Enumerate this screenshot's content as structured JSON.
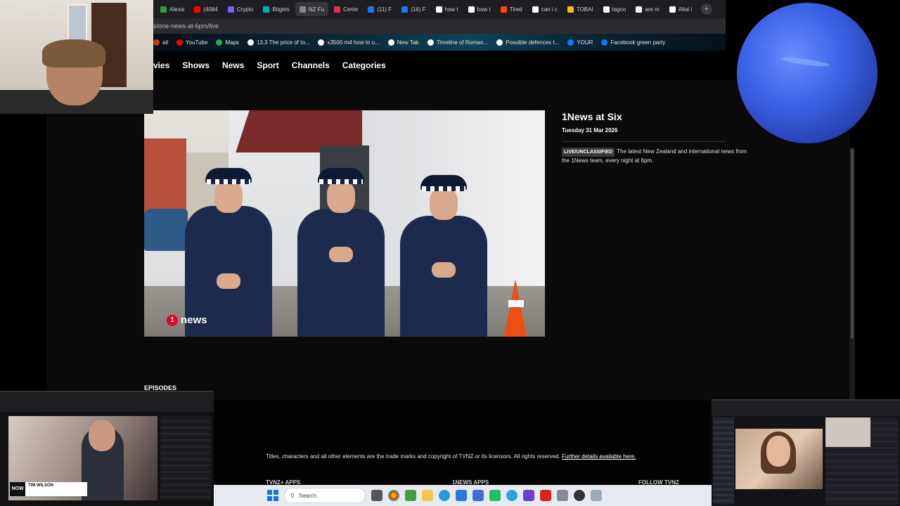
{
  "browser": {
    "tabs": [
      {
        "label": "Alexis",
        "color": "#2ea043"
      },
      {
        "label": "(4084",
        "color": "#ff0000"
      },
      {
        "label": "Crypto",
        "color": "#7a5cff"
      },
      {
        "label": "Bitgets",
        "color": "#00b3b3"
      },
      {
        "label": "NZ Fu",
        "color": "#888888",
        "active": true
      },
      {
        "label": "Cente",
        "color": "#e03050"
      },
      {
        "label": "(11) F",
        "color": "#1877f2"
      },
      {
        "label": "(16) F",
        "color": "#1877f2"
      },
      {
        "label": "how t",
        "color": "#ffffff"
      },
      {
        "label": "how t",
        "color": "#ffffff"
      },
      {
        "label": "Tired",
        "color": "#ff4500"
      },
      {
        "label": "can i c",
        "color": "#ffffff"
      },
      {
        "label": "TOBAI",
        "color": "#f0c020"
      },
      {
        "label": "logno",
        "color": "#ffffff"
      },
      {
        "label": "are m",
        "color": "#ffffff"
      },
      {
        "label": "Altai I",
        "color": "#ffffff"
      }
    ],
    "new_tab": "+",
    "address": "s/one-news-at-6pm/live",
    "bookmarks": [
      {
        "label": "ail",
        "color": "#d93025"
      },
      {
        "label": "YouTube",
        "color": "#ff0000"
      },
      {
        "label": "Maps",
        "color": "#34a853"
      },
      {
        "label": "13.3 The price of to...",
        "color": "#ffffff"
      },
      {
        "label": "x3500 m4 how to u...",
        "color": "#ffffff"
      },
      {
        "label": "New Tab",
        "color": "#ffffff"
      },
      {
        "label": "Timeline of Roman...",
        "color": "#ffffff"
      },
      {
        "label": "Possible defences t...",
        "color": "#ffffff"
      },
      {
        "label": "YOUR",
        "color": "#1877f2"
      },
      {
        "label": "Facebook green party",
        "color": "#1877f2"
      }
    ]
  },
  "site": {
    "nav": [
      "vies",
      "Shows",
      "News",
      "Sport",
      "Channels",
      "Categories"
    ],
    "hero_logo": "news",
    "show_title": "1News at Six",
    "show_date": "Tuesday 31 Mar 2026",
    "rating": "LIVE/UNCLASSIFIED",
    "description": "The latest New Zealand and international news from the 1News team, every night at 6pm.",
    "episodes_label": "EPISODES",
    "copyright": "Titles, characters and all other elements are the trade marks and copyright of TVNZ or its licensors. All rights reserved.",
    "copyright_link": "Further details available here.",
    "footer_cols": [
      "TVNZ+ APPS",
      "1NEWS APPS",
      "FOLLOW TVNZ"
    ]
  },
  "taskbar": {
    "search_placeholder": "Search"
  },
  "pip_left": {
    "badge": "NOW",
    "caption": "TIM WILSON"
  }
}
